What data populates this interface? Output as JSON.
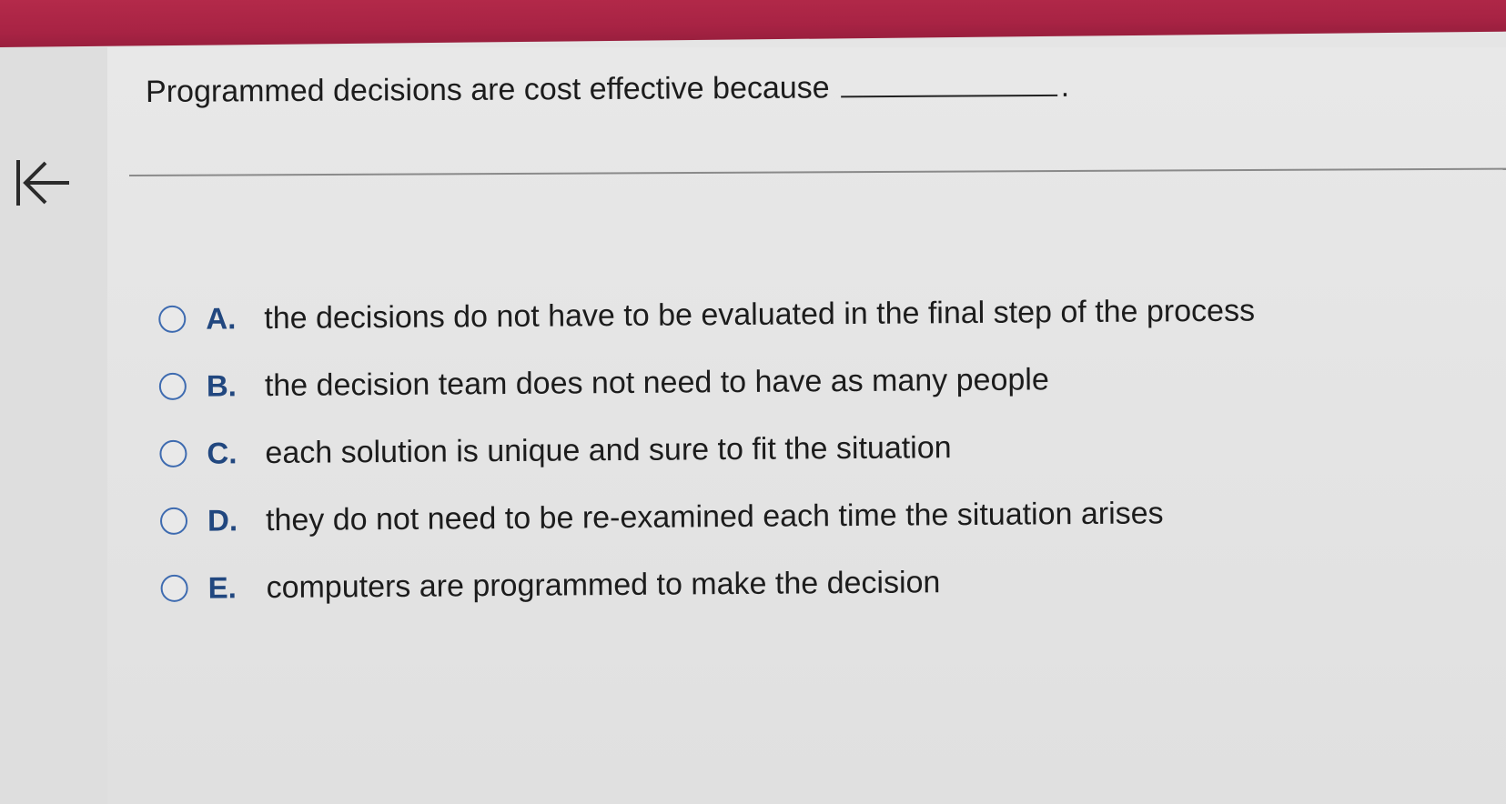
{
  "question": {
    "text": "Programmed decisions are cost effective because",
    "end_punctuation": "."
  },
  "navigation": {
    "back_icon": "first-page-arrow-icon"
  },
  "options": [
    {
      "letter": "A.",
      "text": "the decisions do not have to be evaluated in the final step of the process"
    },
    {
      "letter": "B.",
      "text": "the decision team does not need to have as many people"
    },
    {
      "letter": "C.",
      "text": "each solution is unique and sure to fit the situation"
    },
    {
      "letter": "D.",
      "text": "they do not need to be re-examined each time the situation arises"
    },
    {
      "letter": "E.",
      "text": "computers are programmed to make the decision"
    }
  ],
  "colors": {
    "header": "#a82344",
    "radio_border": "#3e6bb0",
    "letter": "#21477f",
    "text": "#1c1c1c"
  }
}
